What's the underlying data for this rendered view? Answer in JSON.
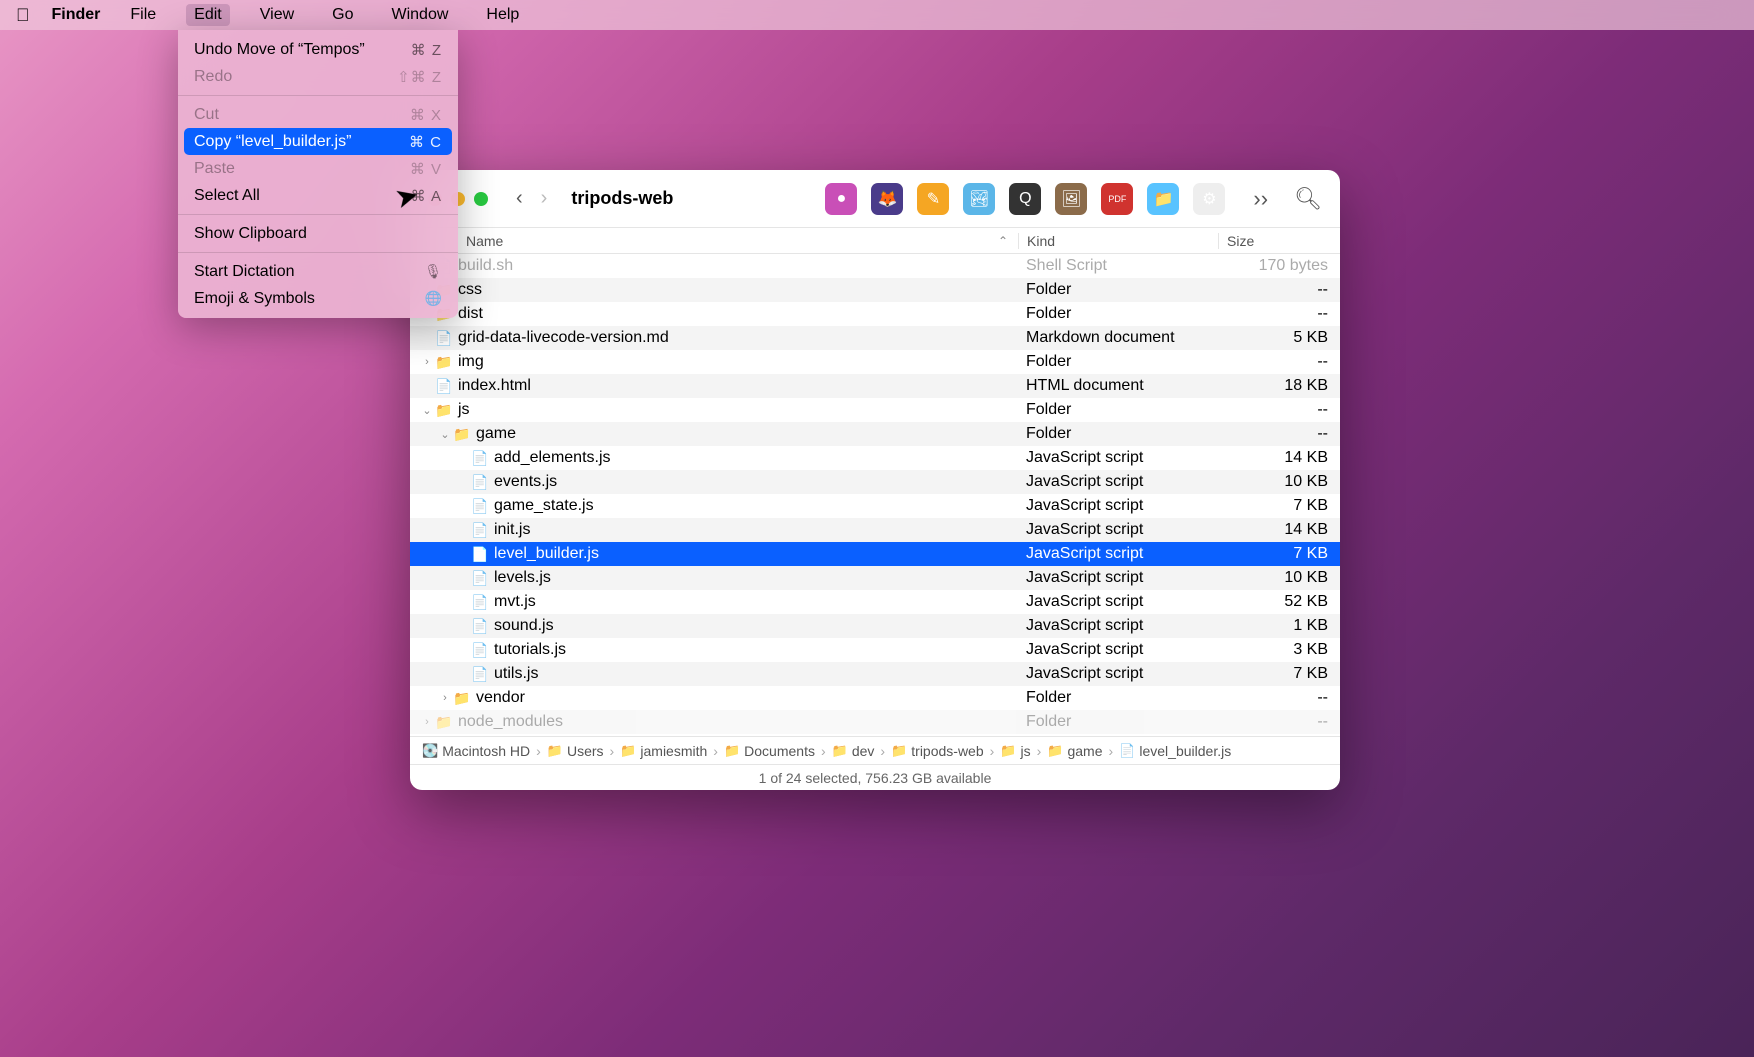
{
  "menubar": {
    "app": "Finder",
    "items": [
      "File",
      "Edit",
      "View",
      "Go",
      "Window",
      "Help"
    ],
    "active": "Edit"
  },
  "edit_menu": {
    "undo": {
      "label": "Undo Move of “Tempos”",
      "shortcut": "⌘ Z"
    },
    "redo": {
      "label": "Redo",
      "shortcut": "⇧⌘ Z"
    },
    "cut": {
      "label": "Cut",
      "shortcut": "⌘ X"
    },
    "copy": {
      "label": "Copy “level_builder.js”",
      "shortcut": "⌘ C"
    },
    "paste": {
      "label": "Paste",
      "shortcut": "⌘ V"
    },
    "select_all": {
      "label": "Select All",
      "shortcut": "⌘ A"
    },
    "show_clipboard": {
      "label": "Show Clipboard"
    },
    "dictation": {
      "label": "Start Dictation",
      "icon": "🎙"
    },
    "emoji": {
      "label": "Emoji & Symbols",
      "icon": "🌐"
    }
  },
  "window": {
    "title": "tripods-web",
    "columns": {
      "name": "Name",
      "kind": "Kind",
      "size": "Size"
    },
    "rows": [
      {
        "indent": 1,
        "disc": "",
        "type": "file",
        "name": "build.sh",
        "kind": "Shell Script",
        "size": "170 bytes",
        "cut": true
      },
      {
        "indent": 1,
        "disc": "",
        "type": "folder",
        "name": "css",
        "kind": "Folder",
        "size": "--"
      },
      {
        "indent": 1,
        "disc": "",
        "type": "folder",
        "name": "dist",
        "kind": "Folder",
        "size": "--"
      },
      {
        "indent": 1,
        "disc": "",
        "type": "file",
        "name": "grid-data-livecode-version.md",
        "kind": "Markdown document",
        "size": "5 KB"
      },
      {
        "indent": 1,
        "disc": "›",
        "type": "folder",
        "name": "img",
        "kind": "Folder",
        "size": "--"
      },
      {
        "indent": 1,
        "disc": "",
        "type": "file",
        "name": "index.html",
        "kind": "HTML document",
        "size": "18 KB"
      },
      {
        "indent": 1,
        "disc": "⌄",
        "type": "folder",
        "name": "js",
        "kind": "Folder",
        "size": "--"
      },
      {
        "indent": 2,
        "disc": "⌄",
        "type": "folder",
        "name": "game",
        "kind": "Folder",
        "size": "--"
      },
      {
        "indent": 3,
        "disc": "",
        "type": "file",
        "name": "add_elements.js",
        "kind": "JavaScript script",
        "size": "14 KB"
      },
      {
        "indent": 3,
        "disc": "",
        "type": "file",
        "name": "events.js",
        "kind": "JavaScript script",
        "size": "10 KB"
      },
      {
        "indent": 3,
        "disc": "",
        "type": "file",
        "name": "game_state.js",
        "kind": "JavaScript script",
        "size": "7 KB"
      },
      {
        "indent": 3,
        "disc": "",
        "type": "file",
        "name": "init.js",
        "kind": "JavaScript script",
        "size": "14 KB"
      },
      {
        "indent": 3,
        "disc": "",
        "type": "file",
        "name": "level_builder.js",
        "kind": "JavaScript script",
        "size": "7 KB",
        "sel": true
      },
      {
        "indent": 3,
        "disc": "",
        "type": "file",
        "name": "levels.js",
        "kind": "JavaScript script",
        "size": "10 KB"
      },
      {
        "indent": 3,
        "disc": "",
        "type": "file",
        "name": "mvt.js",
        "kind": "JavaScript script",
        "size": "52 KB"
      },
      {
        "indent": 3,
        "disc": "",
        "type": "file",
        "name": "sound.js",
        "kind": "JavaScript script",
        "size": "1 KB"
      },
      {
        "indent": 3,
        "disc": "",
        "type": "file",
        "name": "tutorials.js",
        "kind": "JavaScript script",
        "size": "3 KB"
      },
      {
        "indent": 3,
        "disc": "",
        "type": "file",
        "name": "utils.js",
        "kind": "JavaScript script",
        "size": "7 KB"
      },
      {
        "indent": 2,
        "disc": "›",
        "type": "folder",
        "name": "vendor",
        "kind": "Folder",
        "size": "--"
      },
      {
        "indent": 1,
        "disc": "›",
        "type": "folder",
        "name": "node_modules",
        "kind": "Folder",
        "size": "--",
        "cut": true
      }
    ],
    "path": [
      {
        "icon": "💽",
        "label": "Macintosh HD"
      },
      {
        "icon": "📁",
        "label": "Users"
      },
      {
        "icon": "📁",
        "label": "jamiesmith"
      },
      {
        "icon": "📁",
        "label": "Documents"
      },
      {
        "icon": "📁",
        "label": "dev"
      },
      {
        "icon": "📁",
        "label": "tripods-web"
      },
      {
        "icon": "📁",
        "label": "js"
      },
      {
        "icon": "📁",
        "label": "game"
      },
      {
        "icon": "📄",
        "label": "level_builder.js"
      }
    ],
    "status": "1 of 24 selected, 756.23 GB available",
    "toolbar_apps": [
      {
        "name": "app1",
        "bg": "#c94fb7",
        "glyph": "●"
      },
      {
        "name": "firefox",
        "bg": "#4a3b8a",
        "glyph": "🦊"
      },
      {
        "name": "app3",
        "bg": "#f5a623",
        "glyph": "✎"
      },
      {
        "name": "preview",
        "bg": "#5bb6e8",
        "glyph": "🏞"
      },
      {
        "name": "quicktime",
        "bg": "#333",
        "glyph": "Q"
      },
      {
        "name": "app6",
        "bg": "#8b6b4a",
        "glyph": "🖼"
      },
      {
        "name": "pdf",
        "bg": "#d0332f",
        "glyph": "PDF"
      },
      {
        "name": "folder",
        "bg": "#59c3ff",
        "glyph": "📁"
      },
      {
        "name": "app9",
        "bg": "#eee",
        "glyph": "⚙"
      }
    ]
  }
}
